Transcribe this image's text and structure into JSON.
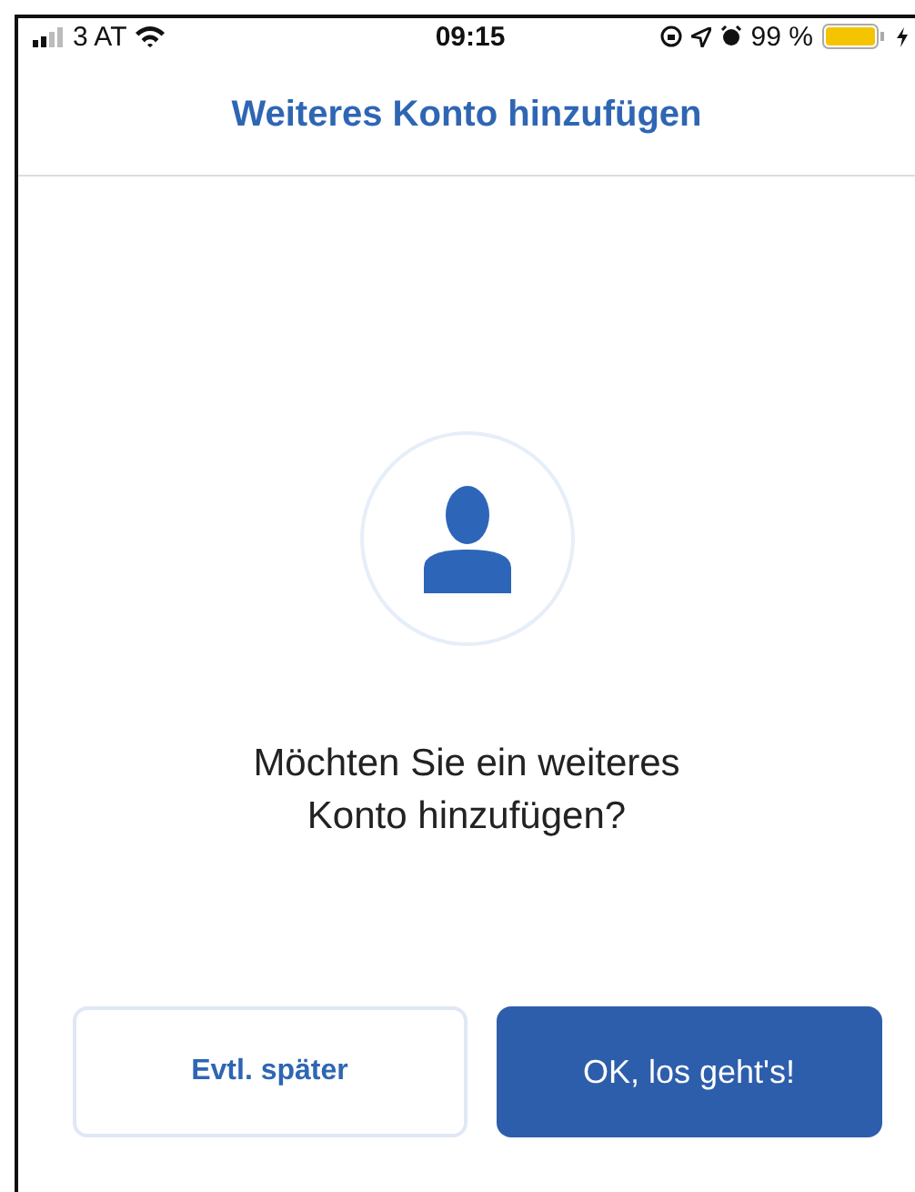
{
  "status_bar": {
    "carrier": "3 AT",
    "time": "09:15",
    "battery": "99 %"
  },
  "header": {
    "title": "Weiteres Konto hinzufügen"
  },
  "prompt": {
    "lines": [
      "Möchten Sie ein weiteres",
      "Konto hinzufügen?"
    ]
  },
  "buttons": [
    {
      "label": "Evtl. später",
      "kind": "secondary"
    },
    {
      "label": "OK, los geht's!",
      "kind": "primary"
    }
  ]
}
